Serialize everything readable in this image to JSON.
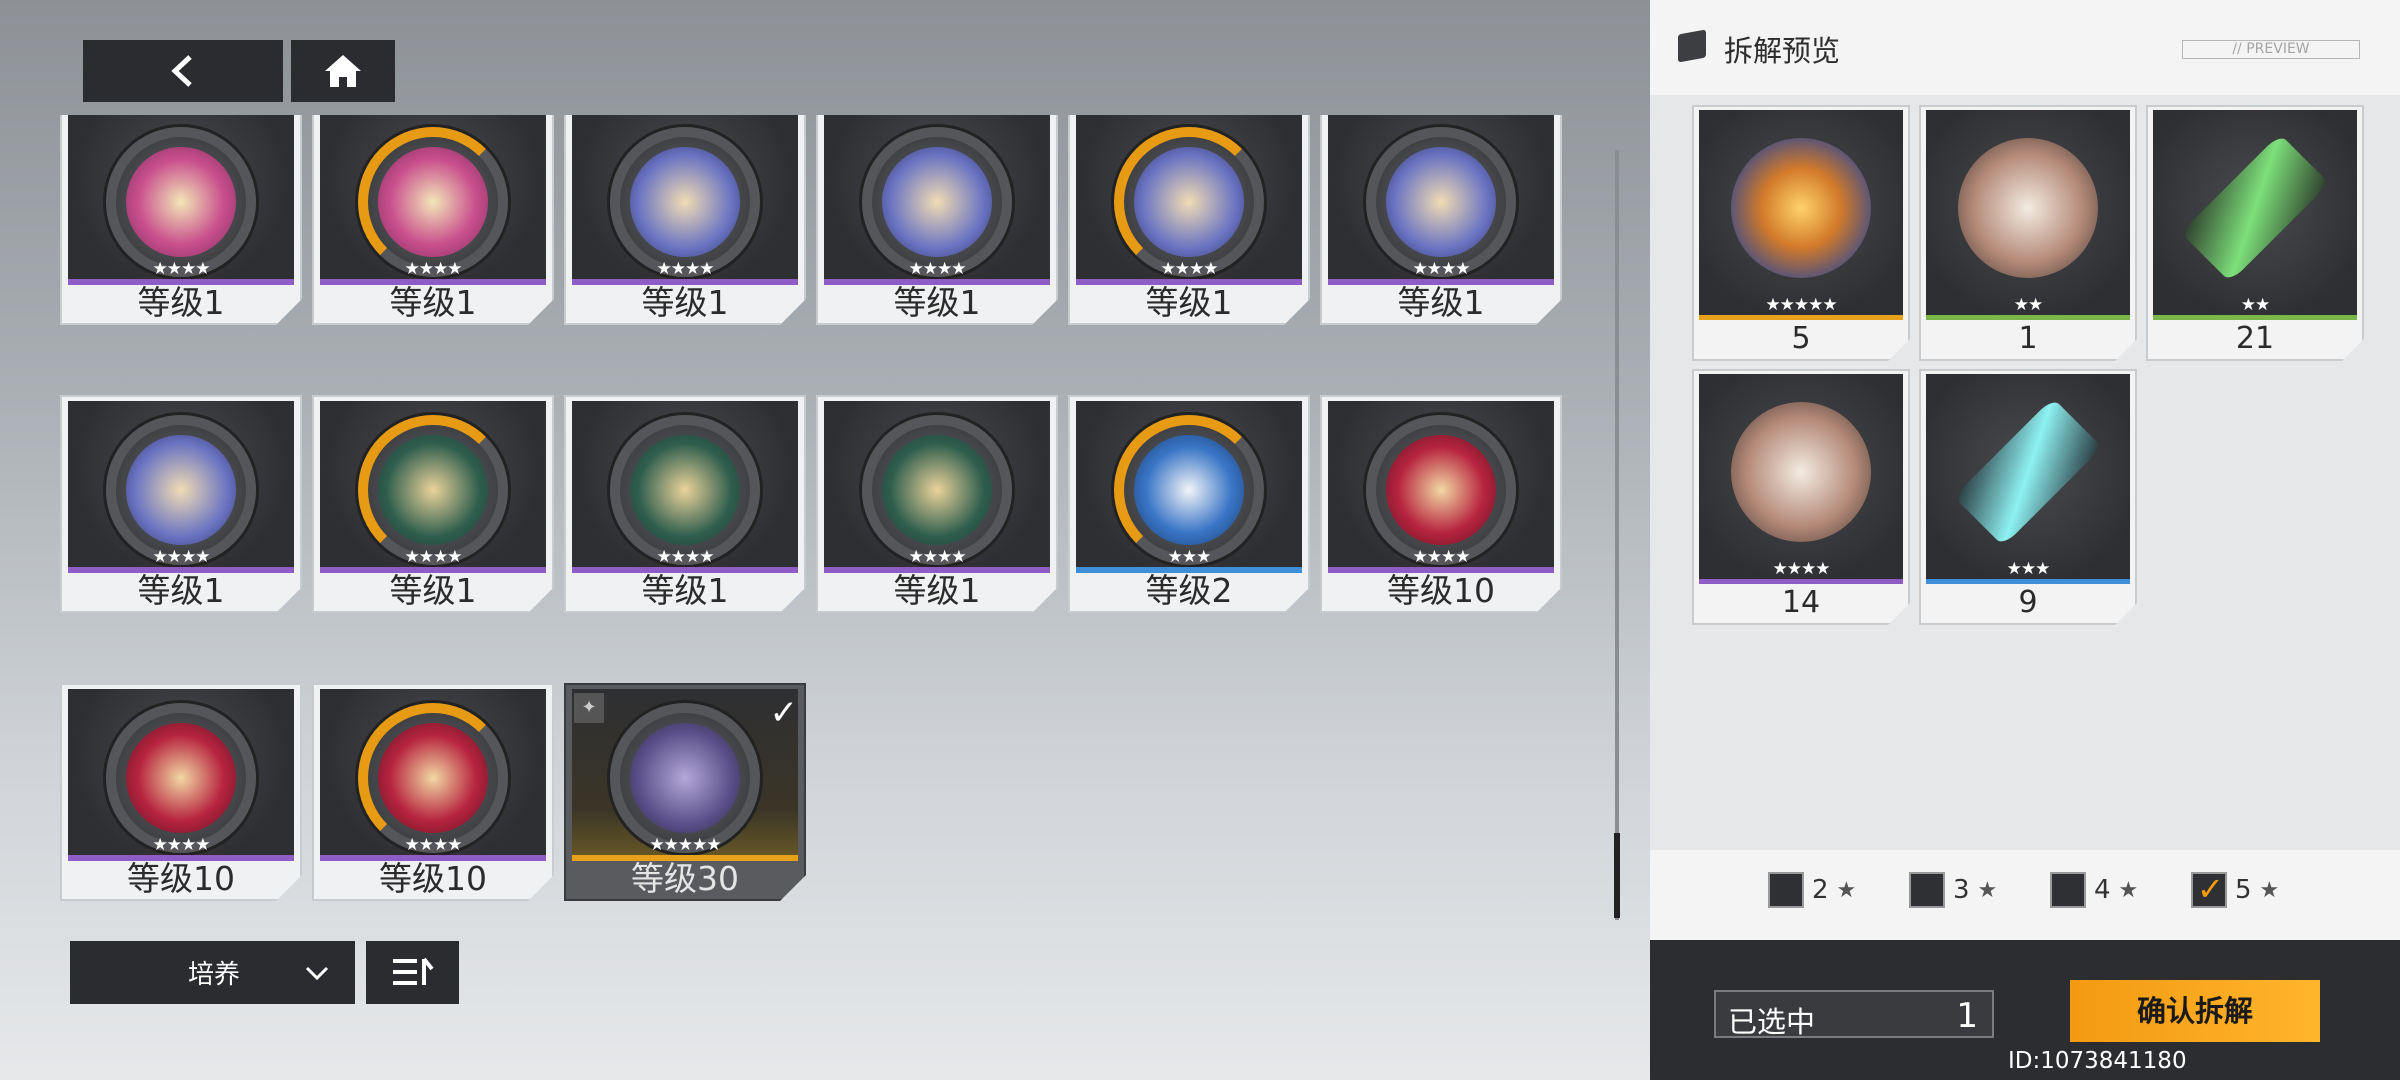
{
  "nav": {
    "back_icon": "chevron-left-icon",
    "home_icon": "home-icon"
  },
  "gear_list": [
    {
      "level": "等级1",
      "stars": "★★★★",
      "rarity": "purple",
      "emblem": "chalice"
    },
    {
      "level": "等级1",
      "stars": "★★★★",
      "rarity": "purple",
      "emblem": "chalice"
    },
    {
      "level": "等级1",
      "stars": "★★★★",
      "rarity": "purple",
      "emblem": "crest"
    },
    {
      "level": "等级1",
      "stars": "★★★★",
      "rarity": "purple",
      "emblem": "crest"
    },
    {
      "level": "等级1",
      "stars": "★★★★",
      "rarity": "purple",
      "emblem": "crest"
    },
    {
      "level": "等级1",
      "stars": "★★★★",
      "rarity": "purple",
      "emblem": "crest"
    },
    {
      "level": "等级1",
      "stars": "★★★★",
      "rarity": "purple",
      "emblem": "crest"
    },
    {
      "level": "等级1",
      "stars": "★★★★",
      "rarity": "purple",
      "emblem": "helmet"
    },
    {
      "level": "等级1",
      "stars": "★★★★",
      "rarity": "purple",
      "emblem": "helmet"
    },
    {
      "level": "等级1",
      "stars": "★★★★",
      "rarity": "purple",
      "emblem": "helmet"
    },
    {
      "level": "等级2",
      "stars": "★★★",
      "rarity": "blue",
      "emblem": "swan"
    },
    {
      "level": "等级10",
      "stars": "★★★★",
      "rarity": "purple",
      "emblem": "dragon"
    },
    {
      "level": "等级10",
      "stars": "★★★★",
      "rarity": "purple",
      "emblem": "dragon"
    },
    {
      "level": "等级10",
      "stars": "★★★★",
      "rarity": "purple",
      "emblem": "dragon"
    },
    {
      "level": "等级30",
      "stars": "★★★★★",
      "rarity": "gold",
      "emblem": "demon",
      "selected": true
    }
  ],
  "bottom_bar": {
    "filter_label": "培养",
    "filter_icon": "chevron-down-icon",
    "sort_icon": "sort-icon"
  },
  "panel": {
    "title": "拆解预览",
    "preview_tag": "// PREVIEW",
    "materials": [
      {
        "count": "5",
        "stars": "★★★★★",
        "rarity": "gold",
        "icon": "crystal-chunk-icon"
      },
      {
        "count": "1",
        "stars": "★★",
        "rarity": "green",
        "icon": "feather-book-icon"
      },
      {
        "count": "21",
        "stars": "★★",
        "rarity": "green",
        "icon": "green-battery-icon"
      },
      {
        "count": "14",
        "stars": "★★★★",
        "rarity": "purple",
        "icon": "feather-book-icon"
      },
      {
        "count": "9",
        "stars": "★★★",
        "rarity": "blue",
        "icon": "cyan-battery-icon"
      }
    ],
    "star_filters": [
      {
        "label": "2",
        "checked": false
      },
      {
        "label": "3",
        "checked": false
      },
      {
        "label": "4",
        "checked": false
      },
      {
        "label": "5",
        "checked": true
      }
    ],
    "selected_label": "已选中",
    "selected_count": "1",
    "confirm_label": "确认拆解",
    "uid": "ID:1073841180"
  },
  "colors": {
    "purple": "#8e5cc4",
    "blue": "#3d8fd8",
    "gold": "#e8a21a",
    "green": "#7ab648",
    "accent": "#f5a11a"
  }
}
